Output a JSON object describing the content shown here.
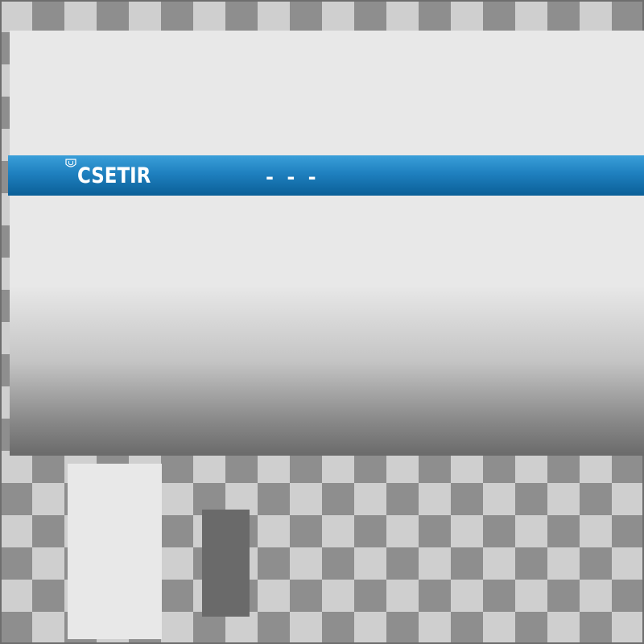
{
  "header": {
    "brand": "CSETIR",
    "dashes": "- - -",
    "logo_icon": "shield-icon"
  },
  "colors": {
    "bar_top": "#3a9fd9",
    "bar_bottom": "#0a5f97",
    "panel": "#e8e8e8",
    "dark_block": "#6a6a6a"
  }
}
